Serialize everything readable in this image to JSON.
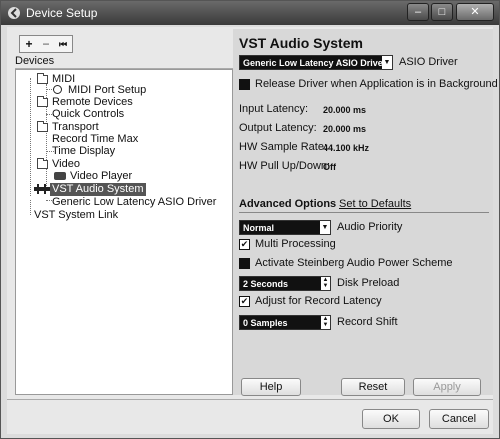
{
  "window": {
    "title": "Device Setup",
    "close_glyph": "✕",
    "minimize_glyph": "–",
    "maximize_glyph": "□"
  },
  "toolbar": {
    "add": "+",
    "remove": "−",
    "reset": "⏮"
  },
  "devices": {
    "header": "Devices",
    "items": [
      {
        "label": "MIDI"
      },
      {
        "label": "MIDI Port Setup"
      },
      {
        "label": "Remote Devices"
      },
      {
        "label": "Quick Controls"
      },
      {
        "label": "Transport"
      },
      {
        "label": "Record Time Max"
      },
      {
        "label": "Time Display"
      },
      {
        "label": "Video"
      },
      {
        "label": "Video Player"
      },
      {
        "label": "VST Audio System"
      },
      {
        "label": "Generic Low Latency ASIO Driver"
      },
      {
        "label": "VST System Link"
      }
    ]
  },
  "vst": {
    "heading": "VST Audio System",
    "asio_driver_value": "Generic Low Latency ASIO Driver",
    "asio_driver_label": "ASIO Driver",
    "release_driver_label": "Release Driver when Application is in Background",
    "input_latency_label": "Input Latency:",
    "input_latency_value": "20.000 ms",
    "output_latency_label": "Output Latency:",
    "output_latency_value": "20.000 ms",
    "sample_rate_label": "HW Sample Rate:",
    "sample_rate_value": "44.100 kHz",
    "pull_label": "HW Pull Up/Down:",
    "pull_value": "Off"
  },
  "advanced": {
    "tab_label": "Advanced Options",
    "defaults_link": "Set to Defaults",
    "audio_priority_value": "Normal",
    "audio_priority_label": "Audio Priority",
    "multi_processing_label": "Multi Processing",
    "multi_processing_checked": true,
    "power_scheme_label": "Activate Steinberg Audio Power Scheme",
    "power_scheme_checked": false,
    "disk_preload_value": "2 Seconds",
    "disk_preload_label": "Disk Preload",
    "adjust_latency_label": "Adjust for Record Latency",
    "adjust_latency_checked": true,
    "record_shift_value": "0 Samples",
    "record_shift_label": "Record Shift"
  },
  "buttons": {
    "help": "Help",
    "reset": "Reset",
    "apply": "Apply",
    "ok": "OK",
    "cancel": "Cancel"
  },
  "check_glyph": "✔"
}
